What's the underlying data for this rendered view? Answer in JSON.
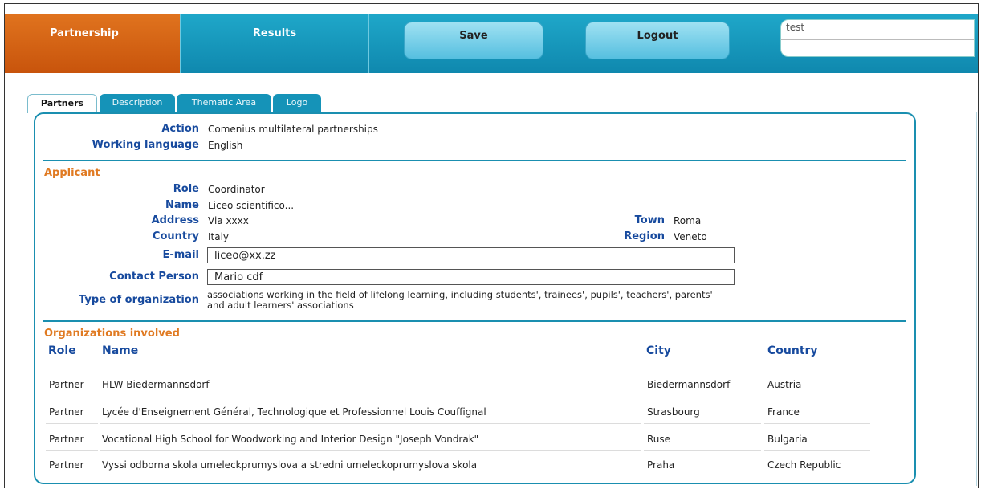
{
  "nav": {
    "partnership": "Partnership",
    "results": "Results",
    "save": "Save",
    "logout": "Logout",
    "user_value": "test"
  },
  "tabs": [
    "Partners",
    "Description",
    "Thematic Area",
    "Logo"
  ],
  "project": {
    "action_label": "Action",
    "action_value": "Comenius multilateral partnerships",
    "language_label": "Working language",
    "language_value": "English"
  },
  "applicant": {
    "section_title": "Applicant",
    "role_label": "Role",
    "role_value": "Coordinator",
    "name_label": "Name",
    "name_value": "Liceo scientifico...",
    "address_label": "Address",
    "address_value": "Via xxxx",
    "town_label": "Town",
    "town_value": "Roma",
    "country_label": "Country",
    "country_value": "Italy",
    "region_label": "Region",
    "region_value": "Veneto",
    "email_label": "E-mail",
    "email_value": "liceo@xx.zz",
    "contact_label": "Contact Person",
    "contact_value": "Mario cdf",
    "orgtype_label": "Type of organization",
    "orgtype_value_1": "associations working in the field of lifelong learning, including students', trainees', pupils', teachers', parents'",
    "orgtype_value_2": "and adult learners' associations"
  },
  "organizations": {
    "section_title": "Organizations involved",
    "headers": {
      "role": "Role",
      "name": "Name",
      "city": "City",
      "country": "Country"
    },
    "rows": [
      {
        "role": "Partner",
        "name": "HLW Biedermannsdorf",
        "city": "Biedermannsdorf",
        "country": "Austria"
      },
      {
        "role": "Partner",
        "name": "Lycée d'Enseignement Général, Technologique et Professionnel Louis Couffignal",
        "city": "Strasbourg",
        "country": "France"
      },
      {
        "role": "Partner",
        "name": "Vocational High School for Woodworking and Interior Design \"Joseph Vondrak\"",
        "city": "Ruse",
        "country": "Bulgaria"
      },
      {
        "role": "Partner",
        "name": "Vyssi odborna skola umeleckprumyslova a stredni umeleckoprumyslova skola",
        "city": "Praha",
        "country": "Czech Republic"
      }
    ]
  }
}
